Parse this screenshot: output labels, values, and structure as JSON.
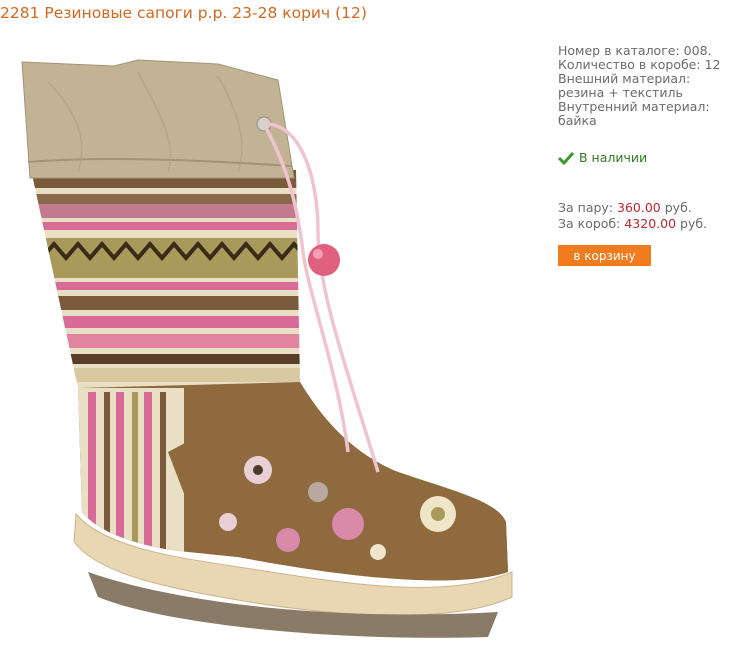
{
  "product": {
    "title": "2281 Резиновые сапоги р.р. 23-28 корич (12)"
  },
  "details": {
    "catalog_label": "Номер в каталоге:",
    "catalog_value": "008.",
    "box_qty_label": "Количество в коробе:",
    "box_qty_value": "12",
    "outer_material_label": "Внешний материал:",
    "outer_material_value": "резина + текстиль",
    "inner_material_label": "Внутренний материал:",
    "inner_material_value": "байка"
  },
  "availability": {
    "icon": "check-icon",
    "text": "В наличии",
    "color": "#2e7d1e"
  },
  "prices": {
    "pair_label": "За пару:",
    "pair_value": "360.00",
    "box_label": "За короб:",
    "box_value": "4320.00",
    "currency": "руб.",
    "price_color": "#c0282b"
  },
  "cart": {
    "button_label": "в корзину",
    "button_color": "#f07c1e"
  },
  "colors": {
    "title": "#d2691e",
    "text": "#6b6b6b"
  }
}
